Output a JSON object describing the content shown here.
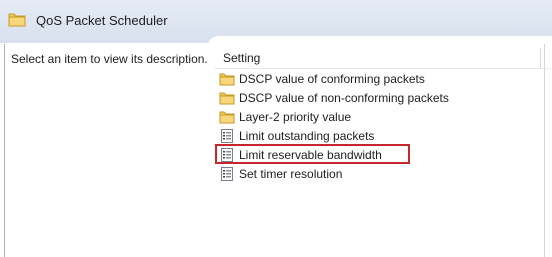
{
  "window": {
    "title": "QoS Packet Scheduler",
    "title_icon": "folder-icon"
  },
  "description_pane": {
    "text": "Select an item to view its description."
  },
  "list": {
    "column_header": "Setting",
    "items": [
      {
        "label": "DSCP value of conforming packets",
        "icon": "folder-icon"
      },
      {
        "label": "DSCP value of non-conforming packets",
        "icon": "folder-icon"
      },
      {
        "label": "Layer-2 priority value",
        "icon": "folder-icon"
      },
      {
        "label": "Limit outstanding packets",
        "icon": "policy-setting-icon"
      },
      {
        "label": "Limit reservable bandwidth",
        "icon": "policy-setting-icon",
        "highlighted": true
      },
      {
        "label": "Set timer resolution",
        "icon": "policy-setting-icon"
      }
    ]
  },
  "colors": {
    "header_bg": "#d7e0ee",
    "folder": "#f1c95b",
    "highlight_border": "#c8262c"
  }
}
